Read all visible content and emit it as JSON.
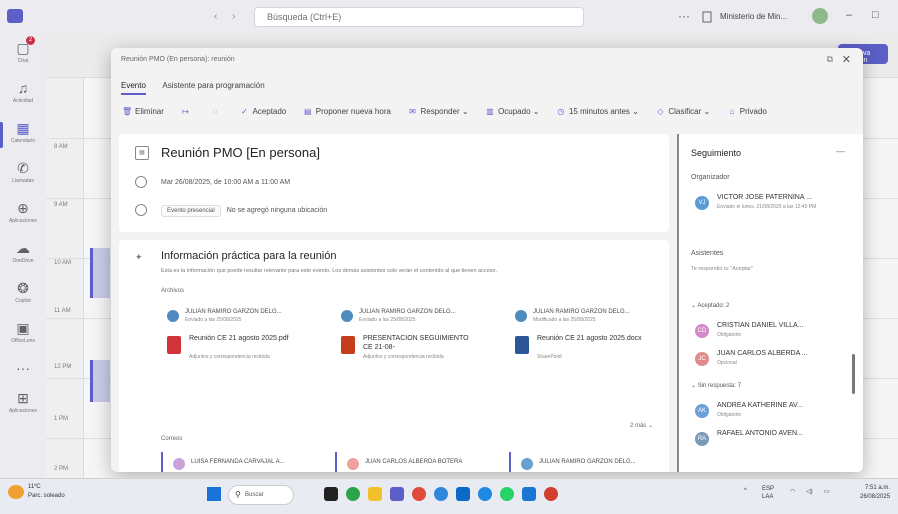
{
  "titlebar": {
    "nav": "‹ ›",
    "search_placeholder": "Búsqueda (Ctrl+E)",
    "more": "···",
    "org": "Ministerio de Min...",
    "minimize": "–",
    "maximize": "□",
    "close": "×"
  },
  "rail": [
    {
      "label": "Chat",
      "icon": "chat-icon",
      "badge": "2"
    },
    {
      "label": "Actividad",
      "icon": "bell-icon"
    },
    {
      "label": "Calendario",
      "icon": "calendar-icon",
      "active": true
    },
    {
      "label": "Llamadas",
      "icon": "phone-icon"
    },
    {
      "label": "Aplicaciones",
      "icon": "apps-icon"
    },
    {
      "label": "OneDrive",
      "icon": "cloud-icon"
    },
    {
      "label": "Copilot",
      "icon": "copilot-icon"
    },
    {
      "label": "OfficeLens",
      "icon": "officelens-icon"
    },
    {
      "label": "",
      "icon": "more-icon"
    },
    {
      "label": "Aplicaciones",
      "icon": "add-apps-icon"
    }
  ],
  "calendar": {
    "new_button": "+ Nueva reunión",
    "times": [
      "8 AM",
      "9 AM",
      "10 AM",
      "11 AM",
      "12 PM",
      "1 PM",
      "2 PM"
    ]
  },
  "modal": {
    "title": "Reunión PMO (En persona): reunión",
    "tabs": [
      {
        "label": "Evento",
        "active": true
      },
      {
        "label": "Asistente para programación",
        "active": false
      }
    ],
    "toolbar": [
      {
        "label": "Eliminar",
        "icon": "trash-icon"
      },
      {
        "label": "",
        "icon": "forward-icon"
      },
      {
        "label": "",
        "icon": "copy-icon"
      },
      {
        "label": "Aceptado",
        "icon": "check-icon"
      },
      {
        "label": "Proponer nueva hora",
        "icon": "propose-time-icon"
      },
      {
        "label": "Responder",
        "icon": "reply-icon"
      },
      {
        "label": "Ocupado",
        "icon": "busy-icon"
      },
      {
        "label": "15 minutos antes",
        "icon": "reminder-icon"
      },
      {
        "label": "Clasificar",
        "icon": "tag-icon"
      },
      {
        "label": "Privado",
        "icon": "lock-icon"
      }
    ],
    "event": {
      "title": "Reunión PMO [En persona]",
      "datetime": "Mar 26/08/2025, de 10:00 AM a 11:00 AM",
      "location_tag": "Evento presencial",
      "location_text": "No se agregó ninguna ubicación"
    },
    "practical": {
      "title": "Información práctica para la reunión",
      "description": "Esta es la información que puede resultar relevante para este evento. Los demás asistentes solo verán el contenido al que tienen acceso.",
      "files_label": "Archivos",
      "files": [
        {
          "author": "JULIAN RAMIRO GARZON DELG...",
          "meta": "Enviado a las 25/08/2025",
          "name": "Reunión CE 21 agosto 2025.pdf",
          "file_meta": "Adjuntos y correspondencia recibida",
          "type": "pdf"
        },
        {
          "author": "JULIAN RAMIRO GARZON DELG...",
          "meta": "Enviado a las 25/08/2025",
          "name": "PRESENTACION SEGUIMIENTO CE 21-08-",
          "file_meta": "Adjuntos y correspondencia recibida",
          "type": "ppt"
        },
        {
          "author": "JULIAN RAMIRO GARZON DELG...",
          "meta": "Modificado a las 25/08/2025",
          "name": "Reunión CE 21 agosto 2025.docx",
          "file_meta": "SharePoint",
          "type": "doc"
        }
      ],
      "more_link": "2 más ⌄",
      "mail_label": "Correos",
      "mails": [
        {
          "name": "LUISA FERNANDA CARVAJAL A...",
          "color": "#c8a2d8"
        },
        {
          "name": "JUAN CARLOS ALBERDA BOTERA",
          "color": "#f0a0a0"
        },
        {
          "name": "JULIAN RAMIRO GARZON DELG...",
          "color": "#6aa0d0"
        }
      ]
    },
    "tracking": {
      "title": "Seguimiento",
      "organizer_label": "Organizador",
      "organizer": {
        "name": "VICTOR JOSE PATERNINA ...",
        "role": "Enviado el lunes, 21/08/2025 a las 12:40 PM",
        "initials": "VJ",
        "color": "#5a9bd4"
      },
      "attendees_label": "Asistentes",
      "attendees_note": "Te respondió tu \"Aceptar\"",
      "accepted_label": "⌄ Aceptado: 2",
      "accepted": [
        {
          "name": "CRISTIAN DANIEL VILLA...",
          "role": "Obligatorio",
          "initials": "CD",
          "color": "#d48ac8"
        },
        {
          "name": "JUAN CARLOS ALBERDA ...",
          "role": "Opcional",
          "initials": "JC",
          "color": "#e08b8b"
        }
      ],
      "no_response_label": "⌄ Sin respuesta: 7",
      "no_response": [
        {
          "name": "ANDREA KATHERINE AV...",
          "role": "Obligatorio",
          "initials": "AK",
          "color": "#6a9fd8"
        },
        {
          "name": "RAFAEL ANTONIO AVEN...",
          "role": "",
          "initials": "RA",
          "color": "#7a9ab8"
        }
      ]
    }
  },
  "taskbar": {
    "weather_temp": "11ºC",
    "weather_desc": "Parc. soleado",
    "search": "Buscar",
    "lang": "ESP",
    "lang2": "LAA",
    "time": "7:51 a.m.",
    "date": "26/08/2025"
  }
}
